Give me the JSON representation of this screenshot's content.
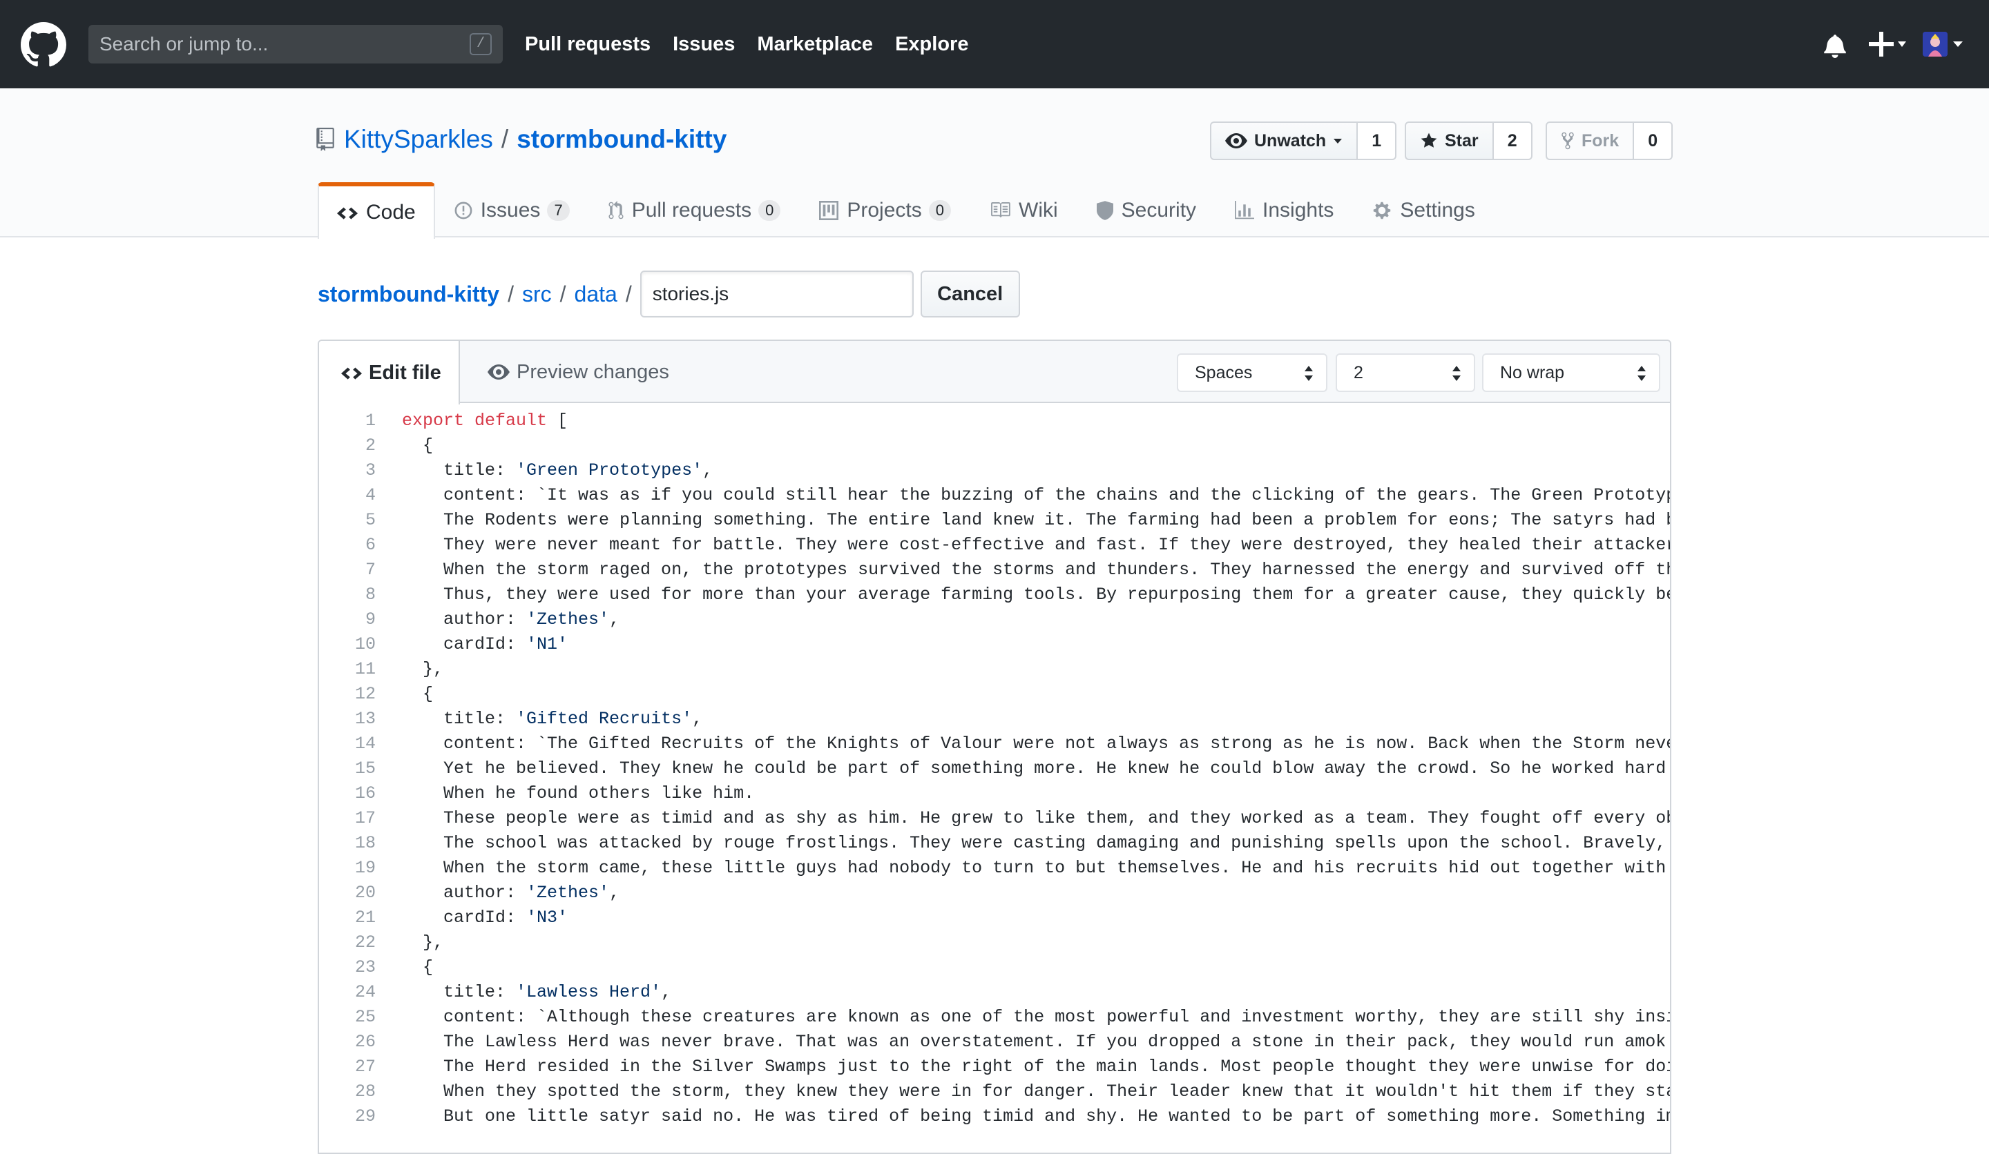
{
  "header": {
    "search_placeholder": "Search or jump to...",
    "search_shortcut": "/",
    "nav": [
      "Pull requests",
      "Issues",
      "Marketplace",
      "Explore"
    ]
  },
  "repo": {
    "owner": "KittySparkles",
    "separator": "/",
    "name": "stormbound-kitty",
    "watch_label": "Unwatch",
    "watch_count": "1",
    "star_label": "Star",
    "star_count": "2",
    "fork_label": "Fork",
    "fork_count": "0"
  },
  "tabs": [
    {
      "label": "Code",
      "icon": "code-icon",
      "counter": ""
    },
    {
      "label": "Issues",
      "icon": "issue-icon",
      "counter": "7"
    },
    {
      "label": "Pull requests",
      "icon": "pull-request-icon",
      "counter": "0"
    },
    {
      "label": "Projects",
      "icon": "project-icon",
      "counter": "0"
    },
    {
      "label": "Wiki",
      "icon": "book-icon",
      "counter": ""
    },
    {
      "label": "Security",
      "icon": "shield-icon",
      "counter": ""
    },
    {
      "label": "Insights",
      "icon": "graph-icon",
      "counter": ""
    },
    {
      "label": "Settings",
      "icon": "gear-icon",
      "counter": ""
    }
  ],
  "breadcrumb": {
    "root": "stormbound-kitty",
    "path": [
      "src",
      "data"
    ],
    "sep": "/",
    "filename": "stories.js",
    "cancel_label": "Cancel"
  },
  "editor": {
    "edit_tab": "Edit file",
    "preview_tab": "Preview changes",
    "indent_mode": "Spaces",
    "indent_size": "2",
    "wrap_mode": "No wrap"
  },
  "code_lines": [
    "export default [",
    "  {",
    "    title: 'Green Prototypes',",
    "    content: `It was as if you could still hear the buzzing of the chains and the clicking of the gears. The Green Prototypes ar",
    "    The Rodents were planning something. The entire land knew it. The farming had been a problem for eons; The satyrs had been c",
    "    They were never meant for battle. They were cost-effective and fast. If they were destroyed, they healed their attacker so m",
    "    When the storm raged on, the prototypes survived the storms and thunders. They harnessed the energy and survived off the lig",
    "    Thus, they were used for more than your average farming tools. By repurposing them for a greater cause, they quickly became",
    "    author: 'Zethes',",
    "    cardId: 'N1'",
    "  },",
    "  {",
    "    title: 'Gifted Recruits',",
    "    content: `The Gifted Recruits of the Knights of Valour were not always as strong as he is now. Back when the Storm never arr",
    "    Yet he believed. They knew he could be part of something more. He knew he could blow away the crowd. So he worked hard and t",
    "    When he found others like him.",
    "    These people were as timid and as shy as him. He grew to like them, and they worked as a team. They fought off every obstacl",
    "    The school was attacked by rouge frostlings. They were casting damaging and punishing spells upon the school. Bravely, the r",
    "    When the storm came, these little guys had nobody to turn to but themselves. He and his recruits hid out together with the r",
    "    author: 'Zethes',",
    "    cardId: 'N3'",
    "  },",
    "  {",
    "    title: 'Lawless Herd',",
    "    content: `Although these creatures are known as one of the most powerful and investment worthy, they are still shy inside.",
    "    The Lawless Herd was never brave. That was an overstatement. If you dropped a stone in their pack, they would run amok. But",
    "    The Herd resided in the Silver Swamps just to the right of the main lands. Most people thought they were unwise for doing so",
    "    When they spotted the storm, they knew they were in for danger. Their leader knew that it wouldn't hit them if they stayed i",
    "    But one little satyr said no. He was tired of being timid and shy. He wanted to be part of something more. Something importa"
  ],
  "colors": {
    "header_bg": "#24292e",
    "link": "#0366d6",
    "tab_accent": "#e36209",
    "keyword": "#d73a49",
    "string": "#032f62"
  }
}
